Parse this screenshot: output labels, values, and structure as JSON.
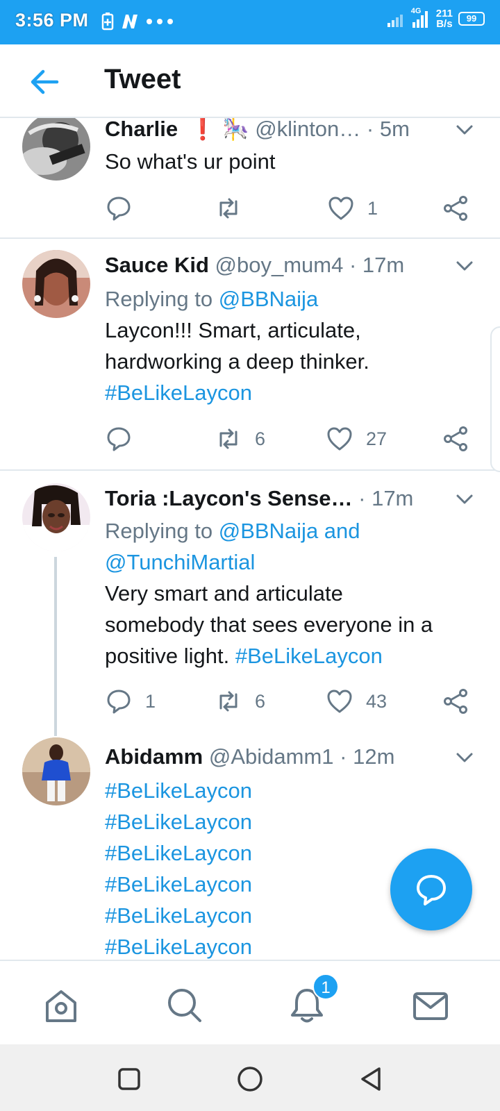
{
  "status_bar": {
    "time": "3:56 PM",
    "network_type": "4G",
    "speed_value": "211",
    "speed_unit": "B/s",
    "battery": "99",
    "icons": [
      "battery-saver-icon",
      "news-icon",
      "more-dots-icon",
      "signal-icon",
      "signal-4g-icon"
    ]
  },
  "header": {
    "title": "Tweet",
    "back_icon": "arrow-left-icon"
  },
  "tweets": [
    {
      "name": "Charlie",
      "emoji_icons": [
        "exclamation-icon",
        "carousel-horse-icon"
      ],
      "handle": "@klinton…",
      "time": "· 5m",
      "text": "So what's ur point",
      "replies": "",
      "retweets": "",
      "likes": "1"
    },
    {
      "name": "Sauce Kid",
      "handle": "@boy_mum4",
      "time": "· 17m",
      "reply_prefix": "Replying to ",
      "reply_to": "@BBNaija",
      "text_line1": "Laycon!!! Smart, articulate,",
      "text_line2": "hardworking a deep thinker.",
      "hashtag": "#BeLikeLaycon",
      "replies": "",
      "retweets": "6",
      "likes": "27"
    },
    {
      "name": "Toria :Laycon's Sense…",
      "handle": "",
      "time": "· 17m",
      "reply_prefix": "Replying to ",
      "reply_to_line1": "@BBNaija and",
      "reply_to_line2": "@TunchiMartial",
      "text_line1": "Very smart and articulate",
      "text_line2": "somebody that sees everyone in a",
      "text_line3": "positive light. ",
      "hashtag": "#BeLikeLaycon",
      "replies": "1",
      "retweets": "6",
      "likes": "43"
    },
    {
      "name": "Abidamm",
      "handle": "@Abidamm1",
      "time": "· 12m",
      "hashtags": [
        "#BeLikeLaycon",
        "#BeLikeLaycon",
        "#BeLikeLaycon",
        "#BeLikeLaycon",
        "#BeLikeLaycon",
        "#BeLikeLaycon"
      ]
    }
  ],
  "fab": {
    "icon": "compose-reply-icon"
  },
  "bottom_nav": {
    "items": [
      "home-icon",
      "search-icon",
      "notifications-icon",
      "messages-icon"
    ],
    "notification_badge": "1"
  },
  "system_nav": [
    "recents-square-icon",
    "home-circle-icon",
    "back-triangle-icon"
  ],
  "colors": {
    "brand": "#1da1f2",
    "link": "#1b95e0",
    "muted": "#657786",
    "divider": "#e1e8ed"
  }
}
